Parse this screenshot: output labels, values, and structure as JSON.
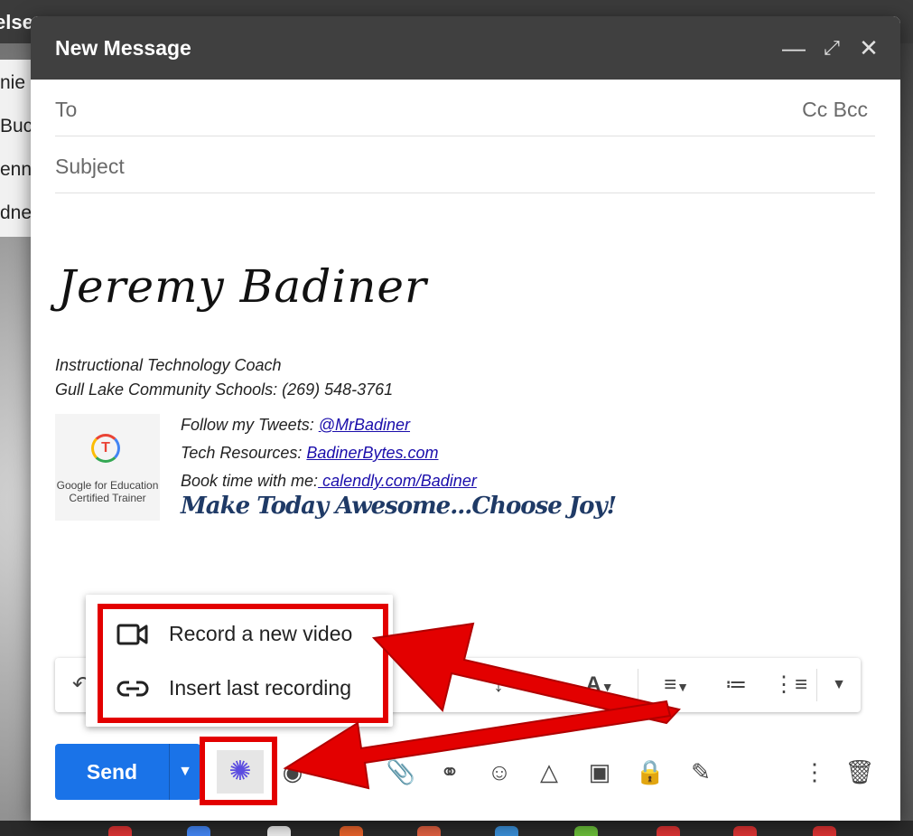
{
  "background": {
    "topbar_text": "else",
    "list_items": [
      "nie",
      "Buc",
      "enn",
      "dne"
    ]
  },
  "compose": {
    "title": "New Message",
    "to_label": "To",
    "cc_bcc_label": "Cc Bcc",
    "subject_placeholder": "Subject"
  },
  "signature": {
    "name": "Jeremy Badiner",
    "role": "Instructional Technology Coach",
    "org": "Gull Lake Community Schools: (269) 548-3761",
    "badge_line1": "Google for Education",
    "badge_line2": "Certified Trainer",
    "tweets_prefix": "Follow my Tweets: ",
    "tweets_link": "@MrBadiner",
    "resources_prefix": "Tech Resources: ",
    "resources_link": "BadinerBytes.com",
    "book_prefix": "Book time with me:",
    "book_link": " calendly.com/Badiner",
    "tagline": "Make Today Awesome...Choose Joy!"
  },
  "popup_menu": {
    "items": [
      {
        "label": "Record a new video",
        "icon": "video-camera-icon"
      },
      {
        "label": "Insert last recording",
        "icon": "link-icon"
      }
    ]
  },
  "actions": {
    "send_label": "Send"
  },
  "colors": {
    "accent_blue": "#1a73e8",
    "highlight_red": "#e30000",
    "extension_icon": "#5b4ce0"
  }
}
